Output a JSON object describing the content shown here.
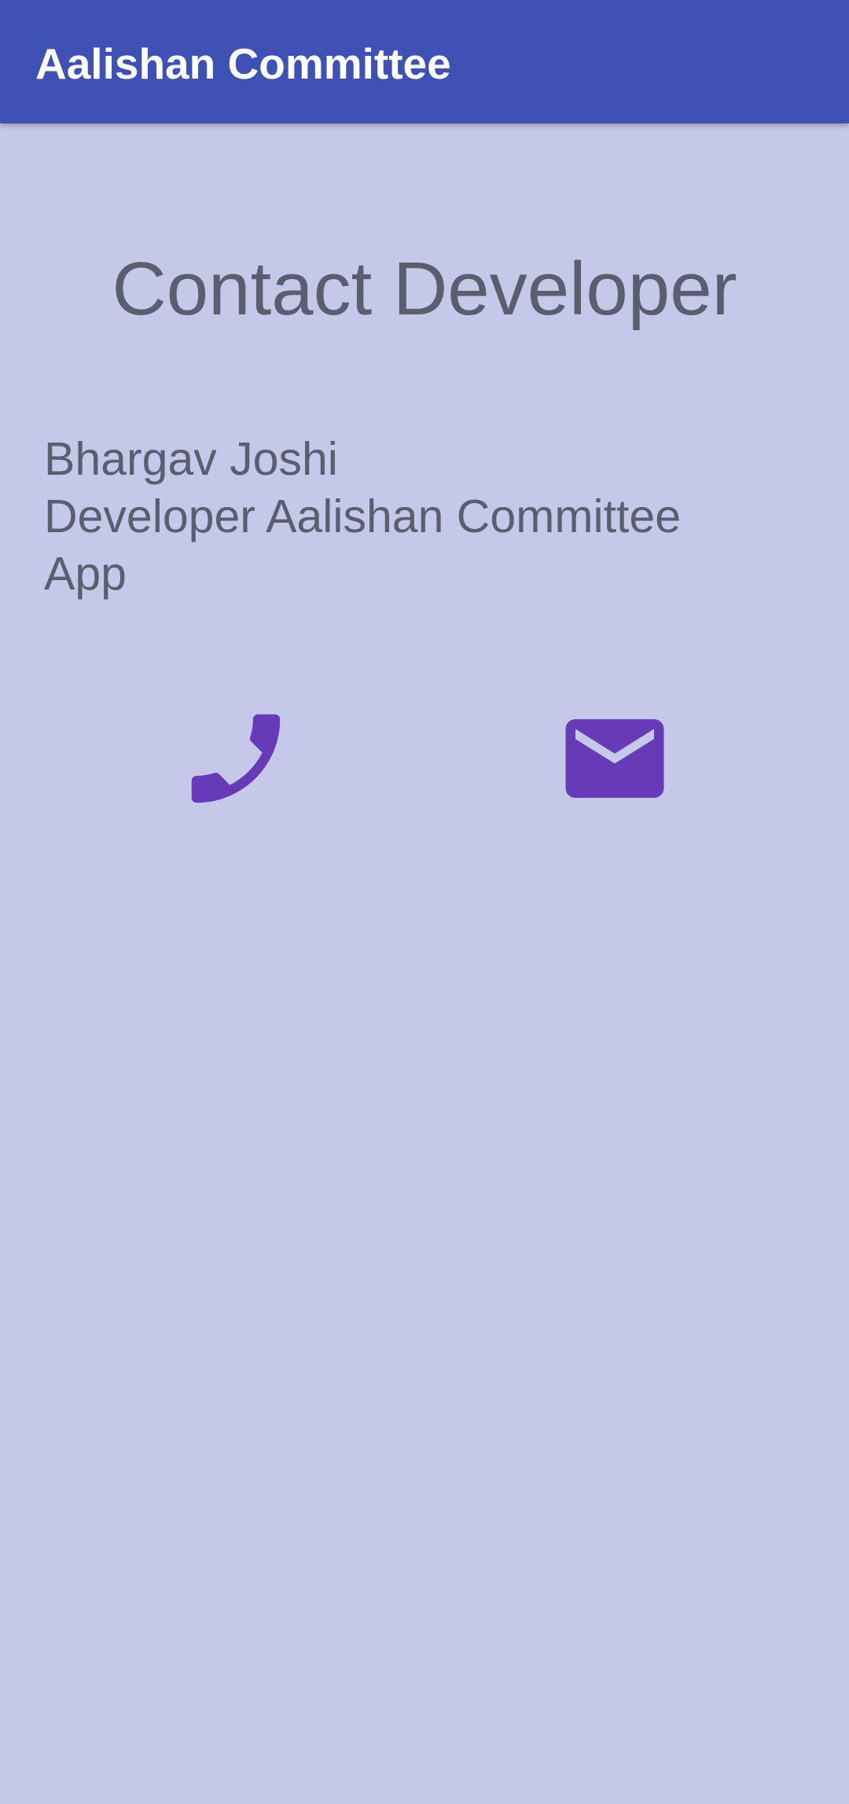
{
  "app_bar": {
    "title": "Aalishan Committee",
    "color": "#3f51b5"
  },
  "page": {
    "heading": "Contact Developer",
    "background": "#c5c8e8"
  },
  "developer": {
    "name": "Bhargav Joshi",
    "role_line": "Developer Aalishan Committee",
    "role_line_2": "App"
  },
  "actions": {
    "call_icon": "phone-icon",
    "email_icon": "mail-icon",
    "icon_color": "#673ab7"
  }
}
